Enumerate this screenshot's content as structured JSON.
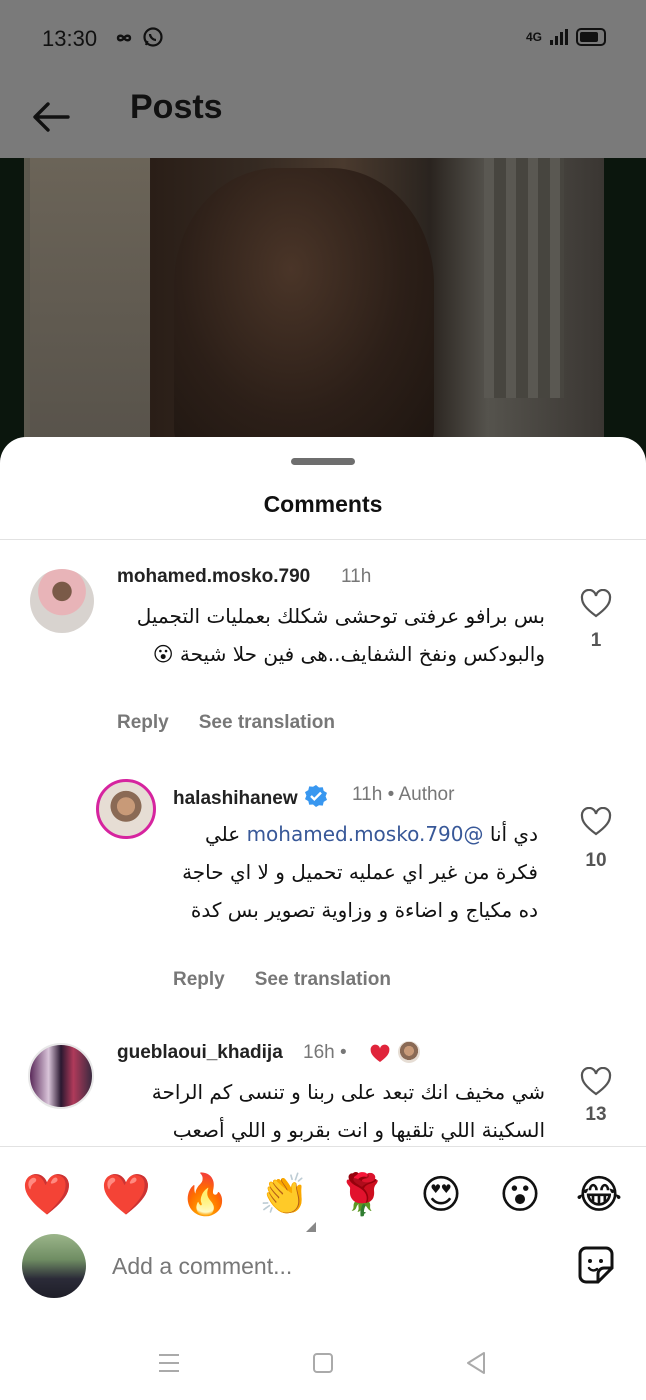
{
  "status_bar": {
    "time": "13:30",
    "left_icons": [
      "infinity-icon",
      "whatsapp-icon"
    ],
    "network": "4G"
  },
  "header": {
    "back_icon": "back-arrow-icon",
    "title": "Posts"
  },
  "sheet": {
    "title": "Comments"
  },
  "comments": [
    {
      "username": "mohamed.mosko.790",
      "time": "11h",
      "text": "بس برافو عرفتى توحشى شكلك بعمليات التجميل والبودكس ونفخ الشفايف..هى فين حلا شيحة 😮",
      "likes": "1",
      "reply_label": "Reply",
      "translate_label": "See translation"
    },
    {
      "username": "halashihanew",
      "time": "11h",
      "author_label": "Author",
      "separator": "•",
      "mention": "@mohamed.mosko.790",
      "text_before": "دي أنا",
      "text_after": "علي فكرة من غير اي عمليه تحميل و لا اي حاجة ده مكياج و اضاءة و وزاوية تصوير بس كدة",
      "likes": "10",
      "reply_label": "Reply",
      "translate_label": "See translation"
    },
    {
      "username": "gueblaoui_khadija",
      "time": "16h",
      "separator": "•",
      "text": "شي مخيف انك تبعد على ربنا و تنسى كم الراحة السكينة اللي تلقيها و انت بقربو و اللي أصعب",
      "likes": "13"
    }
  ],
  "emoji_bar": [
    "❤️",
    "❤️",
    "🔥",
    "👏",
    "🌹",
    "😍",
    "😮",
    "😂"
  ],
  "comment_input": {
    "placeholder": "Add a comment..."
  },
  "colors": {
    "mention": "#385898",
    "verified": "#3897f0",
    "heart_red": "#e0243b",
    "story_ring": "#d6249f"
  }
}
